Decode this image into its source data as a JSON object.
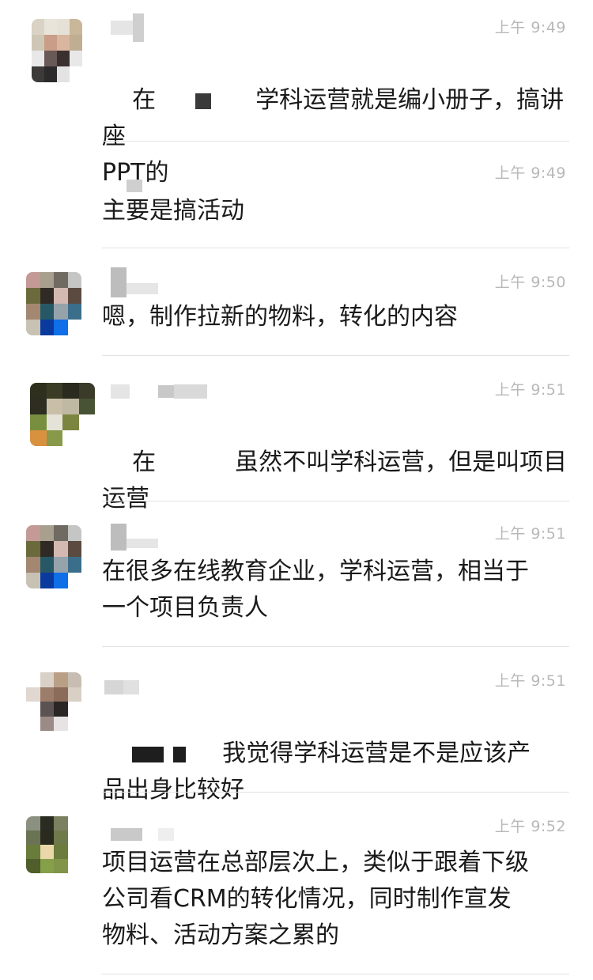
{
  "messages": [
    {
      "time": "上午 9:49",
      "lead": "在",
      "text": "学科运营就是编小册子，搞讲座\nPPT的"
    },
    {
      "time": "上午 9:49",
      "lead": "",
      "text": "主要是搞活动"
    },
    {
      "time": "上午 9:50",
      "lead": "",
      "text": "嗯，制作拉新的物料，转化的内容"
    },
    {
      "time": "上午 9:51",
      "lead": "在",
      "text": "虽然不叫学科运营，但是叫项目\n运营"
    },
    {
      "time": "上午 9:51",
      "lead": "",
      "text": "在很多在线教育企业，学科运营，相当于\n一个项目负责人"
    },
    {
      "time": "上午 9:51",
      "lead": "",
      "text": "我觉得学科运营是不是应该产\n品出身比较好"
    },
    {
      "time": "上午 9:52",
      "lead": "",
      "text": "项目运营在总部层次上，类似于跟着下级\n公司看CRM的转化情况，同时制作宣发\n物料、活动方案之累的"
    }
  ],
  "colors": {
    "text": "#1a1a1a",
    "time": "#b8b8b8",
    "divider": "#e2e2e2"
  }
}
